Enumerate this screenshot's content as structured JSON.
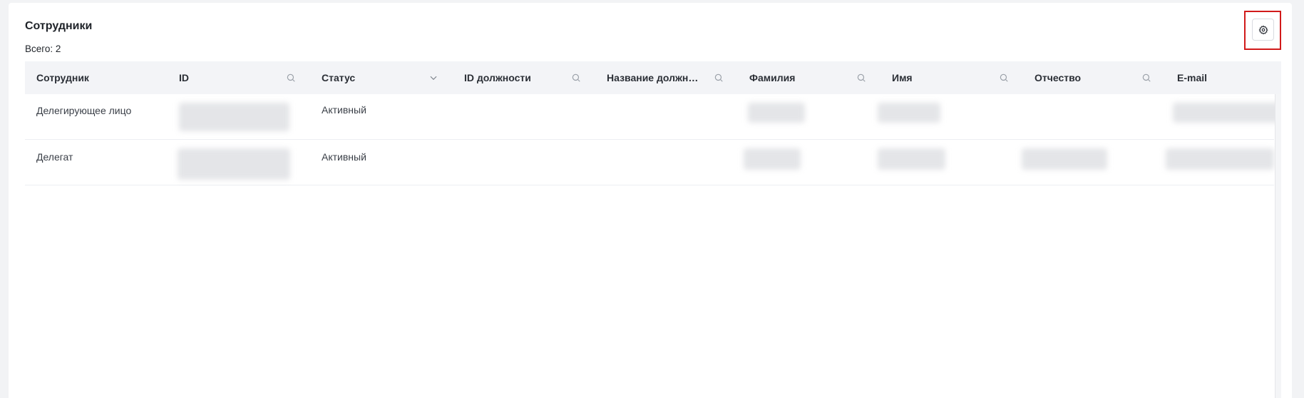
{
  "header": {
    "title": "Сотрудники",
    "total": "Всего: 2"
  },
  "table": {
    "columns": [
      {
        "label": "Сотрудник",
        "icon": "none"
      },
      {
        "label": "ID",
        "icon": "search-icon"
      },
      {
        "label": "Статус",
        "icon": "chevron-down-icon"
      },
      {
        "label": "ID должности",
        "icon": "search-icon"
      },
      {
        "label": "Название должн…",
        "icon": "search-icon"
      },
      {
        "label": "Фамилия",
        "icon": "search-icon"
      },
      {
        "label": "Имя",
        "icon": "search-icon"
      },
      {
        "label": "Отчество",
        "icon": "search-icon"
      },
      {
        "label": "E-mail",
        "icon": "none"
      }
    ],
    "rows": [
      {
        "employee": "Делегирующее лицо",
        "status": "Активный"
      },
      {
        "employee": "Делегат",
        "status": "Активный"
      }
    ]
  },
  "toolbar": {
    "settings_icon": "gear-icon",
    "highlight_color": "#d11a1a"
  }
}
